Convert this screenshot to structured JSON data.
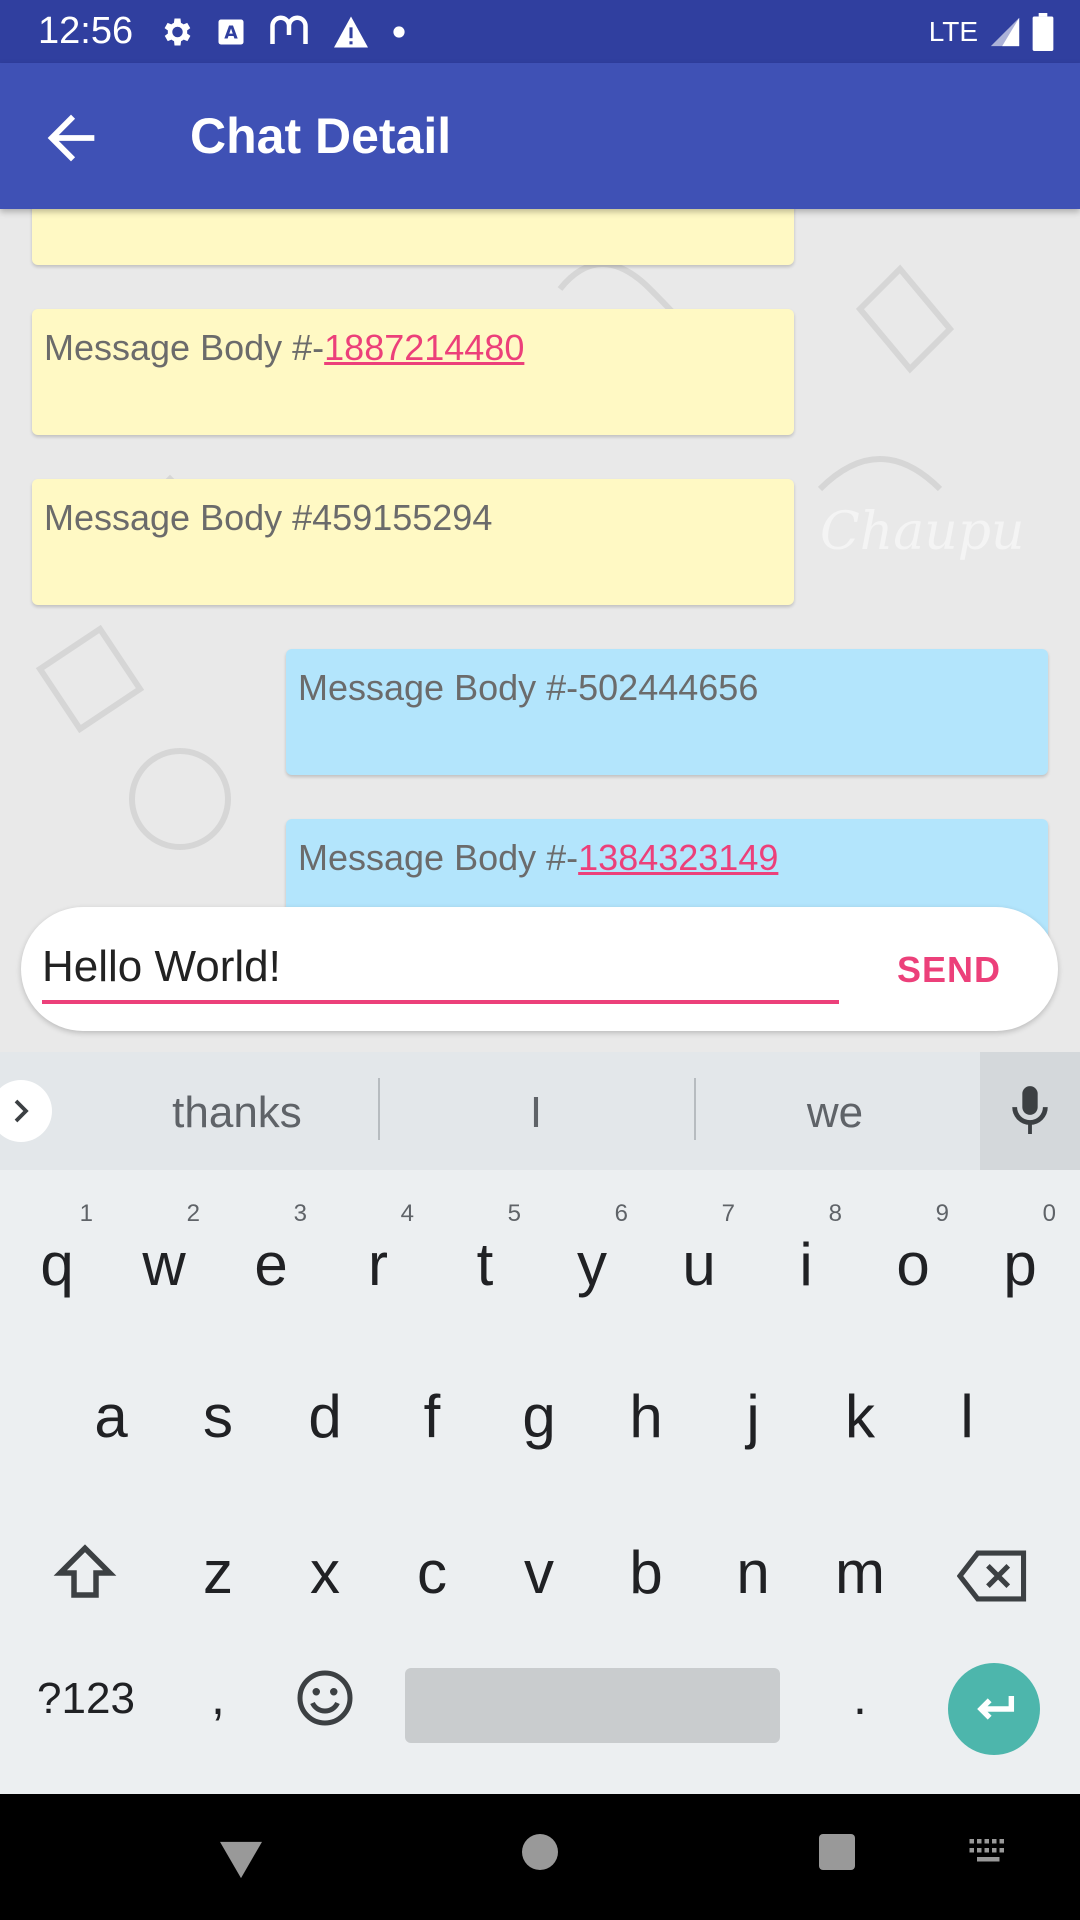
{
  "status_bar": {
    "time": "12:56",
    "network": "LTE",
    "icons_left": [
      "settings-icon",
      "text-a-icon",
      "m-app-icon",
      "warning-icon",
      "dot-icon"
    ],
    "icons_right": [
      "lte-signal-icon",
      "battery-icon"
    ]
  },
  "app_bar": {
    "title": "Chat Detail",
    "back_icon": "arrow-back-icon",
    "color": "#3f51b5",
    "status_color": "#303f9f"
  },
  "messages": [
    {
      "direction": "in",
      "text_prefix": "",
      "link": "",
      "text": ""
    },
    {
      "direction": "in",
      "text_prefix": "Message Body #-",
      "link": "1887214480"
    },
    {
      "direction": "in",
      "text_prefix": "Message Body #459155294",
      "link": ""
    },
    {
      "direction": "out",
      "text_prefix": "Message Body #-502444656",
      "link": ""
    },
    {
      "direction": "out",
      "text_prefix": "Message Body #-",
      "link": "1384323149"
    }
  ],
  "composer": {
    "value": "Hello World!",
    "send_label": "SEND",
    "accent": "#ec407a"
  },
  "keyboard": {
    "suggestions": [
      "thanks",
      "I",
      "we"
    ],
    "row1": [
      {
        "k": "q",
        "h": "1"
      },
      {
        "k": "w",
        "h": "2"
      },
      {
        "k": "e",
        "h": "3"
      },
      {
        "k": "r",
        "h": "4"
      },
      {
        "k": "t",
        "h": "5"
      },
      {
        "k": "y",
        "h": "6"
      },
      {
        "k": "u",
        "h": "7"
      },
      {
        "k": "i",
        "h": "8"
      },
      {
        "k": "o",
        "h": "9"
      },
      {
        "k": "p",
        "h": "0"
      }
    ],
    "row2": [
      "a",
      "s",
      "d",
      "f",
      "g",
      "h",
      "j",
      "k",
      "l"
    ],
    "row3": [
      "z",
      "x",
      "c",
      "v",
      "b",
      "n",
      "m"
    ],
    "symbols_label": "?123",
    "comma_label": ",",
    "period_label": ".",
    "enter_color": "#4db6ac"
  },
  "nav_bar": {
    "icons": [
      "back-triangle-icon",
      "home-circle-icon",
      "recents-square-icon",
      "keyboard-icon"
    ]
  }
}
